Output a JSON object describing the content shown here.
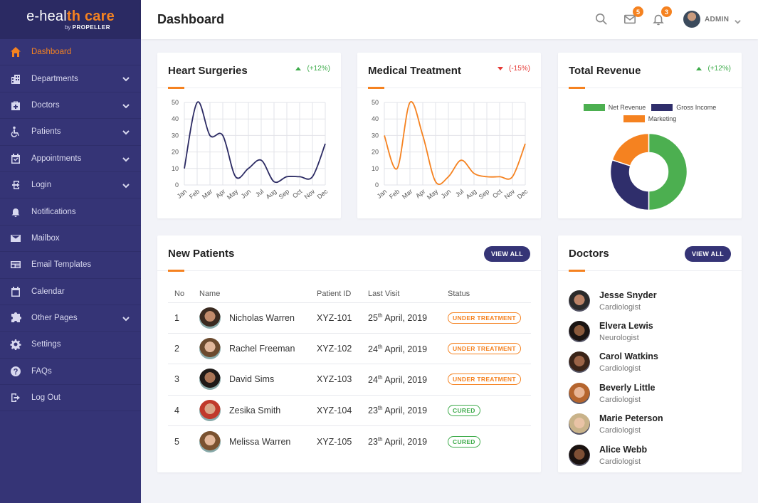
{
  "brand": {
    "part1": "e-heal",
    "part2": "th",
    "part3": "care",
    "by": "by",
    "company": "PROPELLER"
  },
  "sidebar": {
    "items": [
      {
        "label": "Dashboard",
        "icon": "home-icon",
        "active": true,
        "has_children": false
      },
      {
        "label": "Departments",
        "icon": "building-icon",
        "active": false,
        "has_children": true
      },
      {
        "label": "Doctors",
        "icon": "doctor-bag-icon",
        "active": false,
        "has_children": true
      },
      {
        "label": "Patients",
        "icon": "wheelchair-icon",
        "active": false,
        "has_children": true
      },
      {
        "label": "Appointments",
        "icon": "calendar-check-icon",
        "active": false,
        "has_children": true
      },
      {
        "label": "Login",
        "icon": "login-icon",
        "active": false,
        "has_children": true
      },
      {
        "label": "Notifications",
        "icon": "bell-icon",
        "active": false,
        "has_children": false
      },
      {
        "label": "Mailbox",
        "icon": "mail-icon",
        "active": false,
        "has_children": false
      },
      {
        "label": "Email Templates",
        "icon": "template-icon",
        "active": false,
        "has_children": false
      },
      {
        "label": "Calendar",
        "icon": "calendar-icon",
        "active": false,
        "has_children": false
      },
      {
        "label": "Other Pages",
        "icon": "puzzle-icon",
        "active": false,
        "has_children": true
      },
      {
        "label": "Settings",
        "icon": "gear-icon",
        "active": false,
        "has_children": false
      },
      {
        "label": "FAQs",
        "icon": "help-icon",
        "active": false,
        "has_children": false
      },
      {
        "label": "Log Out",
        "icon": "logout-icon",
        "active": false,
        "has_children": false
      }
    ]
  },
  "header": {
    "title": "Dashboard",
    "mail_count": "5",
    "notification_count": "3",
    "user_name": "ADMIN"
  },
  "cards": {
    "heart": {
      "title": "Heart Surgeries",
      "change": "(+12%)",
      "trend": "up"
    },
    "medical": {
      "title": "Medical Treatment",
      "change": "(-15%)",
      "trend": "down"
    },
    "revenue": {
      "title": "Total Revenue",
      "change": "(+12%)",
      "trend": "up"
    }
  },
  "chart_data": [
    {
      "type": "line",
      "title": "Heart Surgeries",
      "categories": [
        "Jan",
        "Feb",
        "Mar",
        "Apr",
        "May",
        "Jun",
        "Jul",
        "Aug",
        "Sep",
        "Oct",
        "Nov",
        "Dec"
      ],
      "series": [
        {
          "values": [
            10,
            50,
            30,
            30,
            5,
            10,
            15,
            2,
            5,
            5,
            5,
            25
          ],
          "color": "#2b2a63"
        }
      ],
      "ylim": [
        0,
        50
      ],
      "yticks": [
        0,
        10,
        20,
        30,
        40,
        50
      ],
      "grid": true
    },
    {
      "type": "line",
      "title": "Medical Treatment",
      "categories": [
        "Jan",
        "Feb",
        "Mar",
        "Apr",
        "May",
        "Jun",
        "Jul",
        "Aug",
        "Sep",
        "Oct",
        "Nov",
        "Dec"
      ],
      "series": [
        {
          "values": [
            30,
            10,
            50,
            30,
            2,
            5,
            15,
            7,
            5,
            5,
            5,
            25
          ],
          "color": "#f58220"
        }
      ],
      "ylim": [
        0,
        50
      ],
      "yticks": [
        0,
        10,
        20,
        30,
        40,
        50
      ],
      "grid": true
    },
    {
      "type": "pie",
      "title": "Total Revenue",
      "donut": true,
      "slices": [
        {
          "label": "Net Revenue",
          "value": 50,
          "color": "#4caf50"
        },
        {
          "label": "Gross Income",
          "value": 30,
          "color": "#2f2e6b"
        },
        {
          "label": "Marketing",
          "value": 20,
          "color": "#f58220"
        }
      ],
      "legend": "top"
    }
  ],
  "patients": {
    "title": "New Patients",
    "view_all": "VIEW ALL",
    "columns": [
      "No",
      "Name",
      "Patient ID",
      "Last Visit",
      "Status"
    ],
    "rows": [
      {
        "no": "1",
        "name": "Nicholas Warren",
        "id": "XYZ-101",
        "day": "25",
        "suffix": "th",
        "rest": " April, 2019",
        "status": "UNDER TREATMENT",
        "kind": "treat",
        "skin": "#c08a6b",
        "hair": "#3a2a20"
      },
      {
        "no": "2",
        "name": "Rachel Freeman",
        "id": "XYZ-102",
        "day": "24",
        "suffix": "th",
        "rest": " April, 2019",
        "status": "UNDER TREATMENT",
        "kind": "treat",
        "skin": "#e0b69a",
        "hair": "#6b4a2e"
      },
      {
        "no": "3",
        "name": "David Sims",
        "id": "XYZ-103",
        "day": "24",
        "suffix": "th",
        "rest": " April, 2019",
        "status": "UNDER TREATMENT",
        "kind": "treat",
        "skin": "#a87456",
        "hair": "#1e1a18"
      },
      {
        "no": "4",
        "name": "Zesika Smith",
        "id": "XYZ-104",
        "day": "23",
        "suffix": "th",
        "rest": " April, 2019",
        "status": "CURED",
        "kind": "cured",
        "skin": "#d9a588",
        "hair": "#c0392b"
      },
      {
        "no": "5",
        "name": "Melissa Warren",
        "id": "XYZ-105",
        "day": "23",
        "suffix": "th",
        "rest": " April, 2019",
        "status": "CURED",
        "kind": "cured",
        "skin": "#e3b89b",
        "hair": "#7a5230"
      }
    ]
  },
  "doctors": {
    "title": "Doctors",
    "view_all": "VIEW ALL",
    "items": [
      {
        "name": "Jesse Snyder",
        "role": "Cardiologist",
        "skin": "#b98266",
        "hair": "#2a2a2a"
      },
      {
        "name": "Elvera Lewis",
        "role": "Neurologist",
        "skin": "#8a5a3c",
        "hair": "#1a1412"
      },
      {
        "name": "Carol Watkins",
        "role": "Cardiologist",
        "skin": "#9b6447",
        "hair": "#3a2418"
      },
      {
        "name": "Beverly Little",
        "role": "Cardiologist",
        "skin": "#e8b595",
        "hair": "#b5652e"
      },
      {
        "name": "Marie Peterson",
        "role": "Cardiologist",
        "skin": "#e9c3a6",
        "hair": "#c9b38a"
      },
      {
        "name": "Alice Webb",
        "role": "Cardiologist",
        "skin": "#7e4f35",
        "hair": "#1a1210"
      }
    ]
  },
  "colors": {
    "accent": "#f58220",
    "primary": "#353476",
    "success": "#3dab4a",
    "danger": "#e53935"
  }
}
